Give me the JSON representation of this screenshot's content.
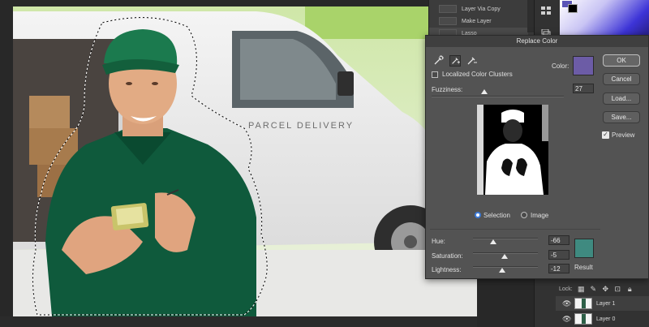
{
  "history": {
    "items": [
      {
        "label": "Layer Via Copy"
      },
      {
        "label": "Make Layer"
      },
      {
        "label": "Lasso"
      }
    ]
  },
  "dialog": {
    "title": "Replace Color",
    "color_label": "Color:",
    "target_color": "#6c5ca6",
    "localized_label": "Localized Color Clusters",
    "localized_checked": false,
    "fuzziness_label": "Fuzziness:",
    "fuzziness_value": "27",
    "fuzziness_fraction": 0.27,
    "view_options": {
      "selection": "Selection",
      "image": "Image",
      "selected": "selection"
    },
    "hue_label": "Hue:",
    "hue_value": "-66",
    "saturation_label": "Saturation:",
    "saturation_value": "-5",
    "lightness_label": "Lightness:",
    "lightness_value": "-12",
    "result_label": "Result",
    "result_color": "#3f8a80",
    "buttons": {
      "ok": "OK",
      "cancel": "Cancel",
      "load": "Load...",
      "save": "Save..."
    },
    "preview_label": "Preview",
    "preview_checked": true
  },
  "layers": {
    "lock_label": "Lock:",
    "items": [
      {
        "label": "Layer 1"
      },
      {
        "label": "Layer 0"
      }
    ]
  },
  "photo": {
    "van_text": "PARCEL DELIVERY"
  },
  "colors": {
    "foreground": "#5a55b7",
    "background": "#000000",
    "accent": "#3d7bd8"
  }
}
